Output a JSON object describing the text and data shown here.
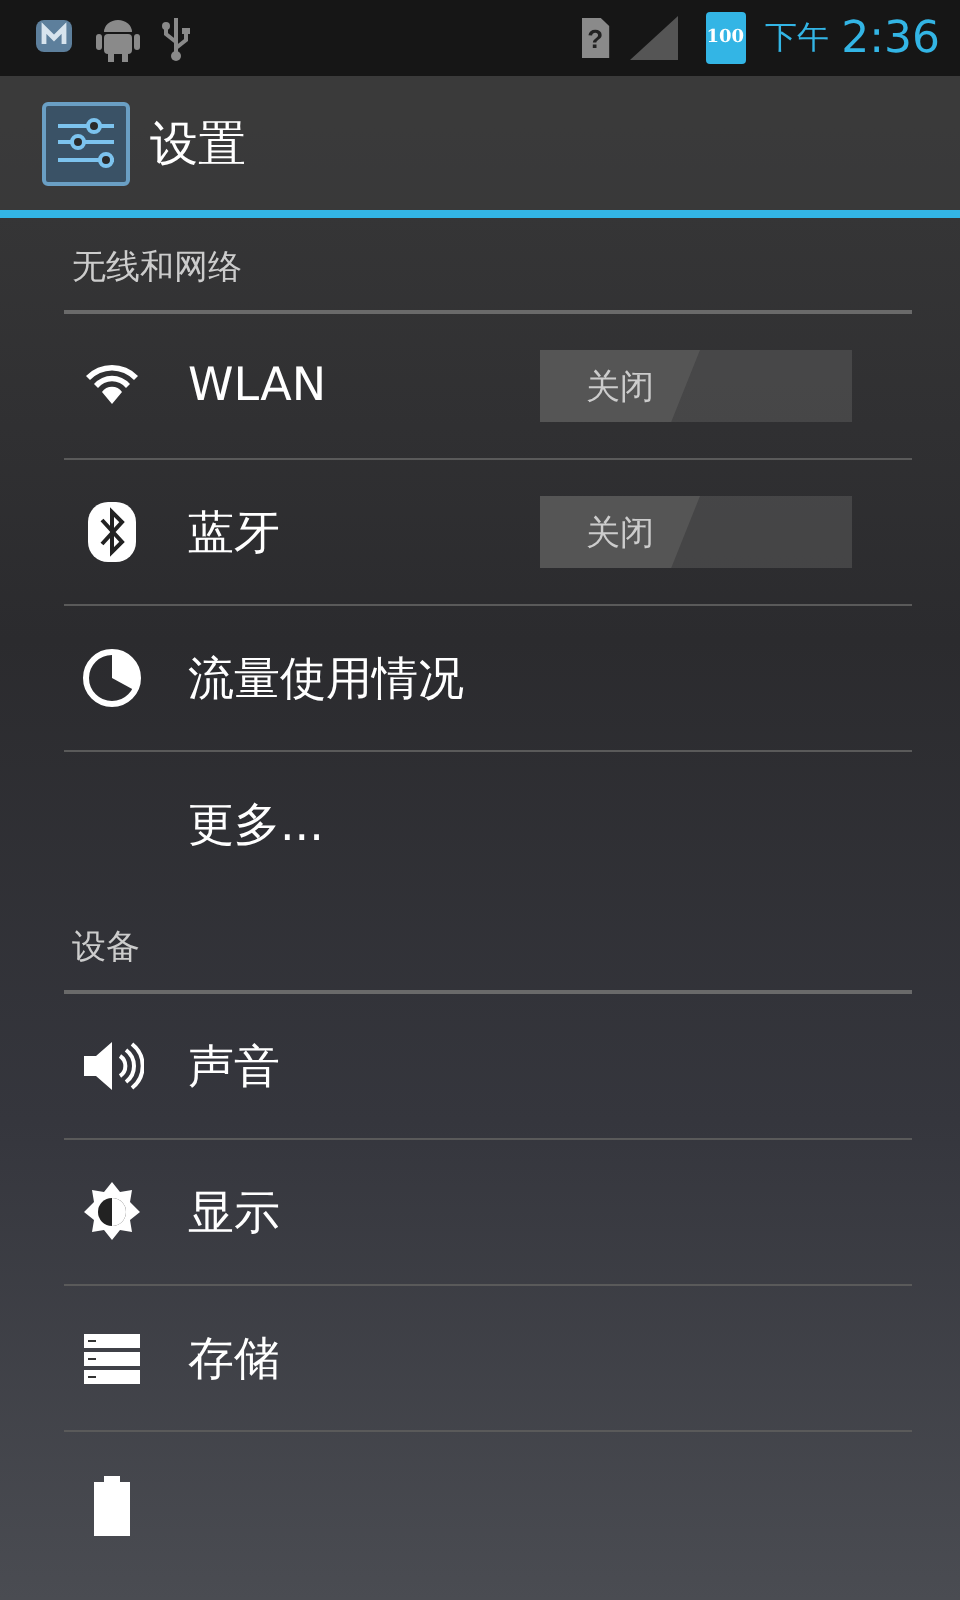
{
  "status_bar": {
    "sim_status": "?",
    "battery": "100",
    "time_period": "下午",
    "time": "2:36"
  },
  "action_bar": {
    "title": "设置"
  },
  "sections": [
    {
      "header": "无线和网络",
      "items": [
        {
          "kind": "switch",
          "label": "WLAN",
          "on": false,
          "switch_label": "关闭"
        },
        {
          "kind": "switch",
          "label": "蓝牙",
          "on": false,
          "switch_label": "关闭"
        },
        {
          "kind": "plain",
          "label": "流量使用情况"
        },
        {
          "kind": "plain",
          "label": "更多..."
        }
      ]
    },
    {
      "header": "设备",
      "items": [
        {
          "kind": "plain",
          "label": "声音"
        },
        {
          "kind": "plain",
          "label": "显示"
        },
        {
          "kind": "plain",
          "label": "存储"
        },
        {
          "kind": "plain"
        }
      ]
    }
  ]
}
